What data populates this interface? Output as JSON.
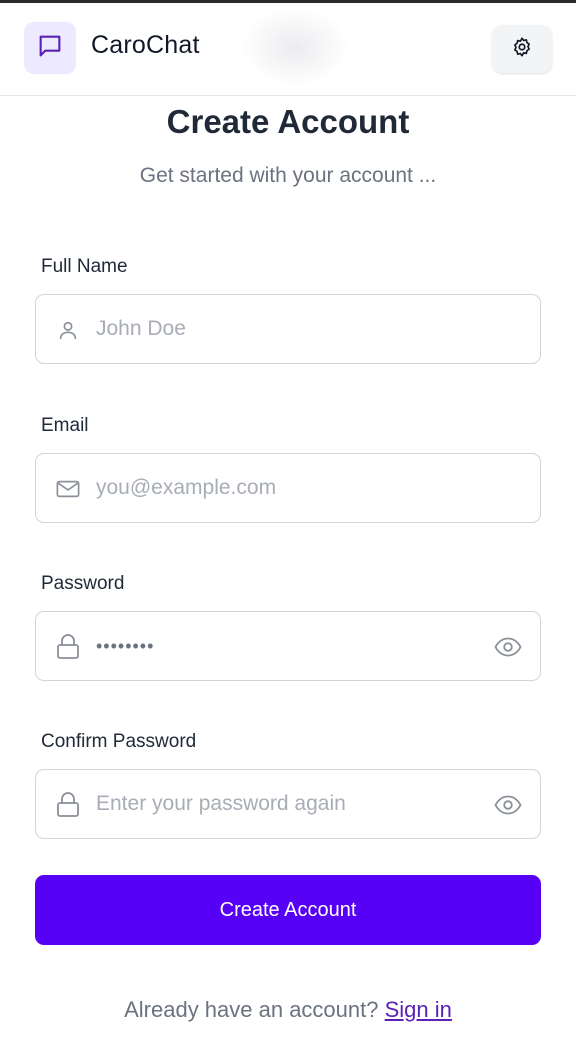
{
  "app": {
    "name": "CaroChat"
  },
  "colors": {
    "accent": "#5600f5",
    "logo_bg": "#ede9fe",
    "link": "#5b21b6"
  },
  "icons": {
    "logo": "chat-bubble-icon",
    "settings": "gear-icon",
    "full_name": "user-icon",
    "email": "mail-icon",
    "password": "lock-icon",
    "confirm_password": "lock-icon",
    "toggle": "eye-icon"
  },
  "page": {
    "title": "Create Account",
    "subtitle": "Get started with your account ..."
  },
  "form": {
    "full_name": {
      "label": "Full Name",
      "placeholder": "John Doe",
      "value": ""
    },
    "email": {
      "label": "Email",
      "placeholder": "you@example.com",
      "value": ""
    },
    "password": {
      "label": "Password",
      "value": "••••••••"
    },
    "confirm_password": {
      "label": "Confirm Password",
      "placeholder": "Enter your password again",
      "value": ""
    },
    "submit_label": "Create Account"
  },
  "footer": {
    "prompt": "Already have an account?",
    "link": "Sign in"
  }
}
